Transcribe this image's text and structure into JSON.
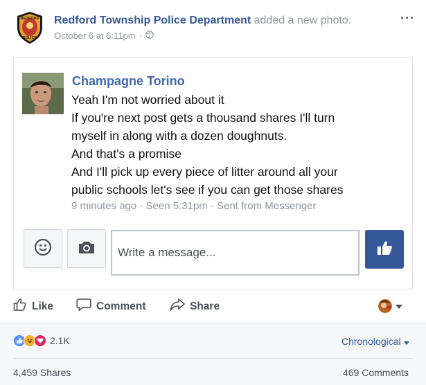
{
  "post": {
    "author": "Redford Township Police Department",
    "action": "added a new photo.",
    "timestamp": "October 6 at 6:11pm",
    "separator": "·",
    "privacy_icon": "globe-icon",
    "more_icon": "more-options-icon",
    "badge_text": [
      "REDFORD",
      "POLICE"
    ]
  },
  "photo": {
    "sender_name": "Champagne Torino",
    "message_lines": [
      "Yeah I'm not worried about it",
      "If you're next post gets a thousand shares I'll turn",
      "myself in along with a dozen doughnuts.",
      "And that's a promise",
      "And I'll pick up every piece of litter around all your",
      "public schools let's see if you can get those shares"
    ],
    "status": "9 minutes ago · Seen 5:31pm · Sent from Messenger",
    "composer": {
      "placeholder": "Write a message...",
      "emoji_icon": "smiley-icon",
      "camera_icon": "camera-icon",
      "send_icon": "thumbs-up-icon"
    }
  },
  "actions": {
    "like_label": "Like",
    "comment_label": "Comment",
    "share_label": "Share"
  },
  "stats": {
    "reaction_icons": [
      "like-reaction-icon",
      "haha-reaction-icon",
      "love-reaction-icon"
    ],
    "reaction_count": "2.1K",
    "sort_label": "Chronological",
    "shares": "4,459 Shares",
    "comments": "469 Comments"
  },
  "colors": {
    "link": "#365899",
    "accent": "#4267b2",
    "muted": "#90949c",
    "like_button": "#365899",
    "love": "#e0245e",
    "haha": "#f7b125"
  }
}
